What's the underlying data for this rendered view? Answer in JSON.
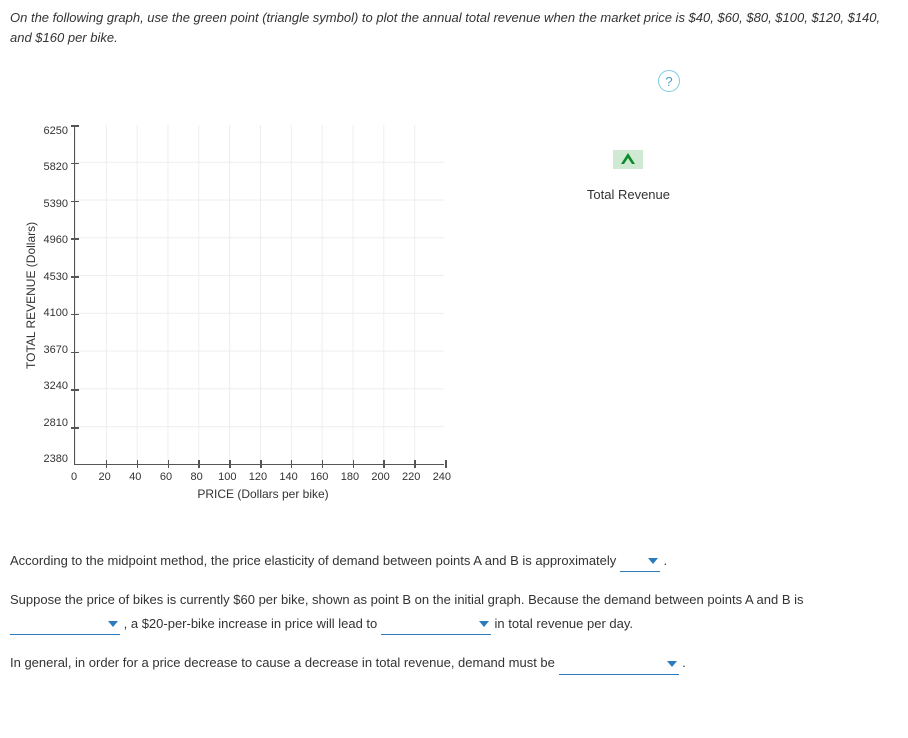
{
  "question": {
    "instruction": "On the following graph, use the green point (triangle symbol) to plot the annual total revenue when the market price is $40, $60, $80, $100, $120, $140, and $160 per bike."
  },
  "help": {
    "symbol": "?"
  },
  "legend": {
    "label": "Total Revenue"
  },
  "chart_data": {
    "type": "scatter",
    "title": "",
    "xlabel": "PRICE (Dollars per bike)",
    "ylabel": "TOTAL REVENUE (Dollars)",
    "xlim": [
      0,
      240
    ],
    "ylim": [
      2380,
      6250
    ],
    "x_ticks": [
      "0",
      "20",
      "40",
      "60",
      "80",
      "100",
      "120",
      "140",
      "160",
      "180",
      "200",
      "220",
      "240"
    ],
    "y_ticks": [
      "6250",
      "5820",
      "5390",
      "4960",
      "4530",
      "4100",
      "3670",
      "3240",
      "2810",
      "2380"
    ],
    "series": [
      {
        "name": "Total Revenue",
        "x": [],
        "y": []
      }
    ]
  },
  "followup": {
    "q1_prefix": "According to the midpoint method, the price elasticity of demand between points A and B is approximately ",
    "q1_suffix": " .",
    "q2_line1": "Suppose the price of bikes is currently $60 per bike, shown as point B on the initial graph. Because the demand between points A and B is",
    "q2_mid": " , a $20-per-bike increase in price will lead to ",
    "q2_suffix": " in total revenue per day.",
    "q3_prefix": "In general, in order for a price decrease to cause a decrease in total revenue, demand must be ",
    "q3_suffix": " ."
  }
}
